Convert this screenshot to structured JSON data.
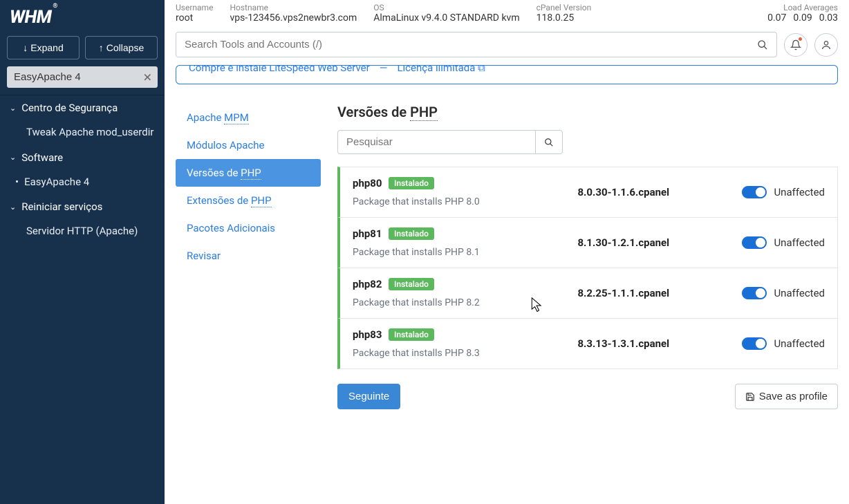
{
  "logo": "WHM",
  "logo_r": "®",
  "buttons": {
    "expand": "Expand",
    "collapse": "Collapse"
  },
  "filter": {
    "value": "EasyApache 4"
  },
  "nav": {
    "g1": "Centro de Segurança",
    "g1_s1": "Tweak Apache mod_userdir",
    "g2": "Software",
    "g2_s1": "EasyApache 4",
    "g3": "Reiniciar serviços",
    "g3_s1": "Servidor HTTP (Apache)"
  },
  "info": {
    "user_lbl": "Username",
    "user_val": "root",
    "host_lbl": "Hostname",
    "host_val": "vps-123456.vps2newbr3.com",
    "os_lbl": "OS",
    "os_val": "AlmaLinux v9.4.0 STANDARD kvm",
    "cp_lbl": "cPanel Version",
    "cp_val": "118.0.25",
    "load_lbl": "Load Averages",
    "l1": "0.07",
    "l2": "0.09",
    "l3": "0.03"
  },
  "search_placeholder": "Search Tools and Accounts (/)",
  "banner": {
    "link1": "Compre e instale LiteSpeed Web Server",
    "dash": "—",
    "link2": "Licença ilimitada"
  },
  "tabs": {
    "t1a": "Apache ",
    "t1b": "MPM",
    "t2": "Módulos Apache",
    "t3a": "Versões de ",
    "t3b": "PHP",
    "t4a": "Extensões de ",
    "t4b": "PHP",
    "t5": "Pacotes Adicionais",
    "t6": "Revisar"
  },
  "heading_a": "Versões de ",
  "heading_b": "PHP",
  "pkg_search_placeholder": "Pesquisar",
  "badge": "Instalado",
  "status": "Unaffected",
  "packages": {
    "p0_name": "php80",
    "p0_desc": "Package that installs PHP 8.0",
    "p0_ver": "8.0.30-1.1.6.cpanel",
    "p1_name": "php81",
    "p1_desc": "Package that installs PHP 8.1",
    "p1_ver": "8.1.30-1.2.1.cpanel",
    "p2_name": "php82",
    "p2_desc": "Package that installs PHP 8.2",
    "p2_ver": "8.2.25-1.1.1.cpanel",
    "p3_name": "php83",
    "p3_desc": "Package that installs PHP 8.3",
    "p3_ver": "8.3.13-1.3.1.cpanel"
  },
  "footer": {
    "next": "Seguinte",
    "save": "Save as profile"
  }
}
